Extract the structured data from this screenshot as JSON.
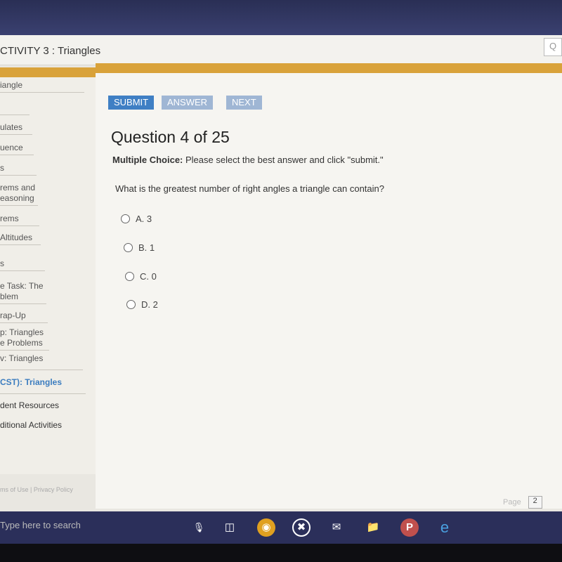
{
  "header": {
    "title": "CTIVITY 3 : Triangles",
    "search_icon": "search-icon"
  },
  "sidebar": {
    "items": [
      {
        "label": "iangle"
      },
      {
        "label": ""
      },
      {
        "label": "ulates"
      },
      {
        "label": "uence"
      },
      {
        "label": "s"
      },
      {
        "label": "rems and easoning"
      },
      {
        "label": "rems"
      },
      {
        "label": "Altitudes"
      },
      {
        "label": "s"
      },
      {
        "label": "e Task: The blem"
      },
      {
        "label": "rap-Up"
      },
      {
        "label": "p: Triangles e Problems"
      },
      {
        "label": "v: Triangles"
      },
      {
        "label": "CST): Triangles"
      },
      {
        "label": "dent Resources"
      },
      {
        "label": "ditional Activities"
      }
    ]
  },
  "toolbar": {
    "submit": "SUBMIT",
    "answer": "ANSWER",
    "next": "NEXT"
  },
  "question": {
    "title": "Question 4 of 25",
    "instruction_label": "Multiple Choice:",
    "instruction": " Please select the best answer and click \"submit.\"",
    "text": "What is the greatest number of right angles a triangle can contain?",
    "options": [
      {
        "label": "A.  3"
      },
      {
        "label": "B.  1"
      },
      {
        "label": "C.  0"
      },
      {
        "label": "D.  2"
      }
    ]
  },
  "footer": {
    "links": "ms of Use  |  Privacy Policy",
    "page_label": "Page",
    "page_value": "2"
  },
  "taskbar": {
    "search_placeholder": "Type here to search"
  },
  "colors": {
    "accent": "#d9a23a",
    "submit": "#3f7fc4",
    "disabled": "#9fb6d4",
    "active_link": "#3c7dbf"
  }
}
